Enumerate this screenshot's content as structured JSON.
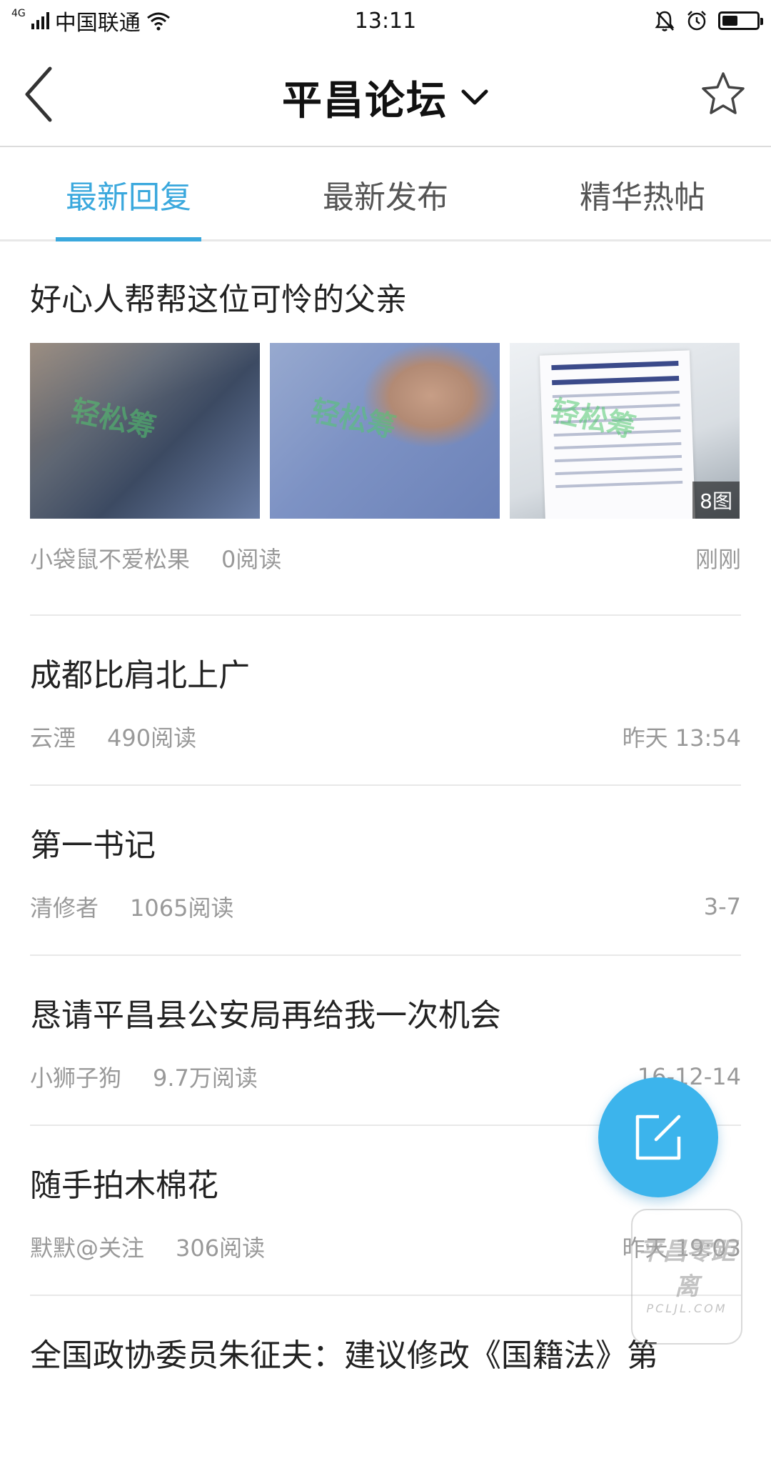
{
  "status_bar": {
    "network": "4G",
    "carrier": "中国联通",
    "time": "13:11",
    "battery_level": 0.45
  },
  "header": {
    "title": "平昌论坛",
    "back_icon": "back-arrow-icon",
    "dropdown_icon": "chevron-down-icon",
    "favorite_icon": "star-icon"
  },
  "tabs": [
    {
      "label": "最新回复",
      "active": true
    },
    {
      "label": "最新发布",
      "active": false
    },
    {
      "label": "精华热帖",
      "active": false
    }
  ],
  "posts": [
    {
      "title": "好心人帮帮这位可怜的父亲",
      "author": "小袋鼠不爱松果",
      "reads": "0阅读",
      "time": "刚刚",
      "image_count": "8图",
      "image_watermark": "轻松筹"
    },
    {
      "title": "成都比肩北上广",
      "author": "云湮",
      "reads": "490阅读",
      "time": "昨天 13:54"
    },
    {
      "title": "第一书记",
      "author": "清修者",
      "reads": "1065阅读",
      "time": "3-7"
    },
    {
      "title": "恳请平昌县公安局再给我一次机会",
      "author": "小狮子狗",
      "reads": "9.7万阅读",
      "time": "16-12-14"
    },
    {
      "title": "随手拍木棉花",
      "author": "默默@关注",
      "reads": "306阅读",
      "time": "昨天 19:03"
    },
    {
      "title": "全国政协委员朱征夫：建议修改《国籍法》第"
    }
  ],
  "fab": {
    "icon": "compose-icon"
  },
  "site_watermark": {
    "title": "平昌零距离",
    "sub": "PCLJL.COM"
  },
  "colors": {
    "accent": "#3aa8dd",
    "fab": "#3cb4ec",
    "meta_text": "#999999"
  }
}
